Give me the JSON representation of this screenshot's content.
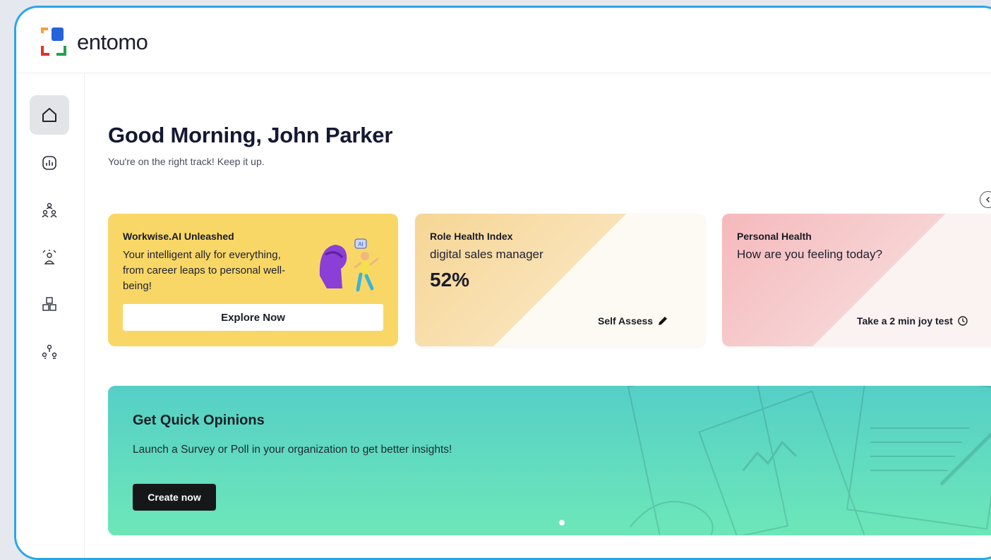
{
  "brand": {
    "name": "entomo"
  },
  "sidebar": {
    "items": [
      {
        "icon": "home-icon",
        "active": true
      },
      {
        "icon": "chart-icon",
        "active": false
      },
      {
        "icon": "team-network-icon",
        "active": false
      },
      {
        "icon": "person-expand-icon",
        "active": false
      },
      {
        "icon": "cubes-icon",
        "active": false
      },
      {
        "icon": "org-chart-icon",
        "active": false
      }
    ]
  },
  "header": {
    "greeting": "Good Morning, John Parker",
    "subtitle": "You're on the right track! Keep it up."
  },
  "cards": {
    "workwise": {
      "title": "Workwise.AI Unleashed",
      "body": "Your intelligent ally for everything, from career leaps to personal well-being!",
      "button": "Explore Now",
      "illustration_badge": "AI"
    },
    "role_health": {
      "title": "Role Health Index",
      "role": "digital sales manager",
      "percent": "52%",
      "action": "Self Assess"
    },
    "personal_health": {
      "title": "Personal Health",
      "question": "How are you feeling today?",
      "action": "Take a 2 min joy test"
    }
  },
  "banner": {
    "title": "Get Quick Opinions",
    "text": "Launch a Survey or Poll in your organization to get better insights!",
    "button": "Create now"
  },
  "colors": {
    "frame_border": "#2aa6e6",
    "workwise_bg": "#f8d766",
    "banner_start": "#55cfc6",
    "banner_end": "#6de7b8",
    "text_dark": "#141833"
  }
}
